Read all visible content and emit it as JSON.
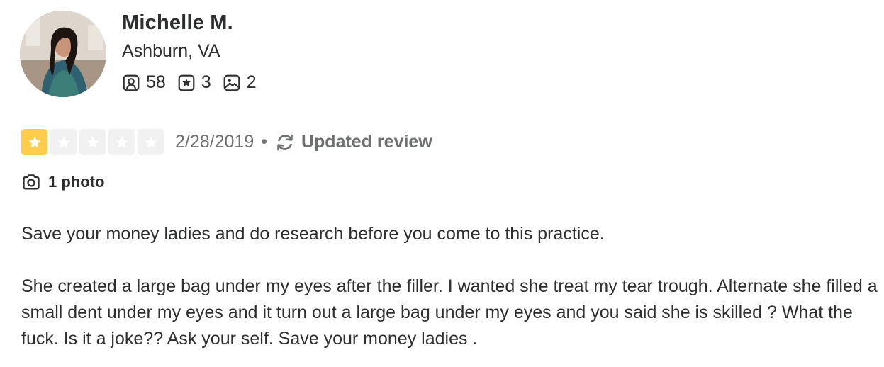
{
  "user": {
    "name": "Michelle M.",
    "location": "Ashburn, VA",
    "stats": {
      "friends": "58",
      "reviews": "3",
      "photos": "2"
    },
    "avatar_icon": "user-profile-photo"
  },
  "review": {
    "rating": 1,
    "rating_max": 5,
    "star_filled_color": "#ffcc4b",
    "star_empty_color": "#f1f1f1",
    "date": "2/28/2019",
    "separator": "•",
    "status_label": "Updated review",
    "status_icon": "refresh-icon",
    "photo_count_label": "1 photo",
    "paragraphs": [
      "Save your money ladies and do research before you come to this practice.",
      "She created a large bag under my eyes after the filler. I wanted she treat my tear trough. Alternate she filled a small dent under my eyes and it turn out a large bag under my eyes and you said she is skilled ? What the fuck. Is it a joke?? Ask your self. Save your money ladies ."
    ]
  }
}
